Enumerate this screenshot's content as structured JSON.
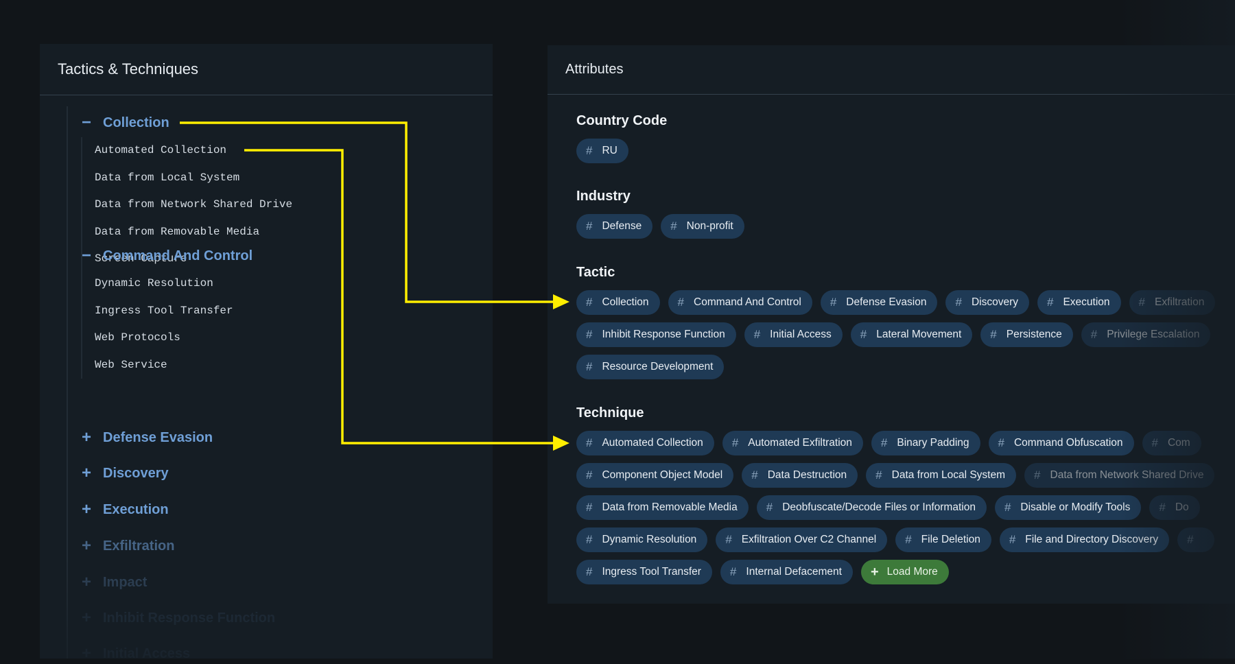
{
  "left_panel": {
    "title": "Tactics & Techniques",
    "tree": [
      {
        "label": "Collection",
        "expanded": true,
        "icon": "minus-icon",
        "children": [
          "Automated Collection",
          "Data from Local System",
          "Data from Network Shared Drive",
          "Data from Removable Media",
          "Screen Capture"
        ]
      },
      {
        "label": "Command And Control",
        "expanded": true,
        "icon": "minus-icon",
        "children": [
          "Dynamic Resolution",
          "Ingress Tool Transfer",
          "Web Protocols",
          "Web Service"
        ]
      },
      {
        "label": "Defense Evasion",
        "expanded": false,
        "icon": "plus-icon"
      },
      {
        "label": "Discovery",
        "expanded": false,
        "icon": "plus-icon"
      },
      {
        "label": "Execution",
        "expanded": false,
        "icon": "plus-icon"
      },
      {
        "label": "Exfiltration",
        "expanded": false,
        "icon": "plus-icon"
      },
      {
        "label": "Impact",
        "expanded": false,
        "icon": "plus-icon"
      },
      {
        "label": "Inhibit Response Function",
        "expanded": false,
        "icon": "plus-icon"
      },
      {
        "label": "Initial Access",
        "expanded": false,
        "icon": "plus-icon"
      }
    ]
  },
  "right_panel": {
    "title": "Attributes",
    "sections": [
      {
        "title": "Country Code",
        "tags": [
          "RU"
        ]
      },
      {
        "title": "Industry",
        "tags": [
          "Defense",
          "Non-profit"
        ]
      },
      {
        "title": "Tactic",
        "tags": [
          "Collection",
          "Command And Control",
          "Defense Evasion",
          "Discovery",
          "Execution",
          "Exfiltration",
          "Inhibit Response Function",
          "Initial Access",
          "Lateral Movement",
          "Persistence",
          "Privilege Escalation",
          "Resource Development"
        ]
      },
      {
        "title": "Technique",
        "tags": [
          "Automated Collection",
          "Automated Exfiltration",
          "Binary Padding",
          "Command Obfuscation",
          "Com",
          "Component Object Model",
          "Data Destruction",
          "Data from Local System",
          "Data from Network Shared Drive",
          "Data from Removable Media",
          "Deobfuscate/Decode Files or Information",
          "Disable or Modify Tools",
          "Do",
          "Dynamic Resolution",
          "Exfiltration Over C2 Channel",
          "File Deletion",
          "File and Directory Discovery",
          "",
          "Ingress Tool Transfer",
          "Internal Defacement"
        ],
        "load_more": "Load More"
      }
    ],
    "tag_icon": "hash-icon"
  },
  "colors": {
    "background": "#111519",
    "panel": "#151d24",
    "tactic_link": "#6f9fd6",
    "chip": "#1f3a55",
    "load_more": "#3d7a3a",
    "annotation_arrow": "#ffee00"
  }
}
